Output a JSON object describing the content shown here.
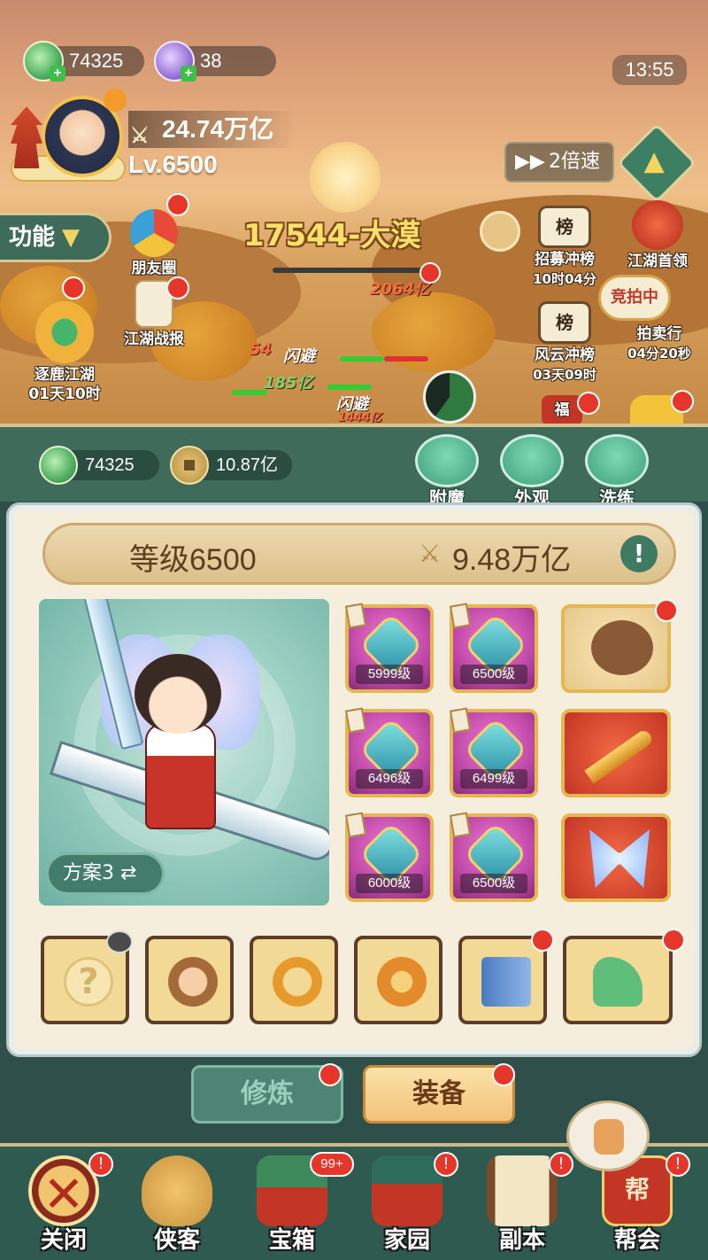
{
  "top_resources": {
    "jade": "74325",
    "purple": "38",
    "plus": "+"
  },
  "clock": "13:55",
  "player": {
    "power": "24.74万亿",
    "level": "Lv.6500"
  },
  "controls": {
    "speed": "2倍速",
    "func": "功能",
    "func_chevron": "▼",
    "collapse_chevron": "▲",
    "ff_glyph": "▶▶",
    "swords_glyph": "⚔"
  },
  "stage": {
    "title": "17544-大漠",
    "damage": [
      "2064亿",
      "54",
      "185亿",
      "1444亿"
    ],
    "dodge": [
      "闪避",
      "闪避"
    ]
  },
  "scene_icons": {
    "friends": "朋友圈",
    "battle_report": "江湖战报",
    "zhulu": "逐鹿江湖",
    "zhulu_time": "01天10时",
    "recruit": "招募冲榜",
    "recruit_time": "10时04分",
    "leader": "江湖首领",
    "auction_badge": "竞拍中",
    "fengyun": "风云冲榜",
    "fengyun_time": "03天09时",
    "auction": "拍卖行",
    "auction_time": "04分20秒",
    "bang": "榜",
    "fu": "福"
  },
  "panel_bar": {
    "jade": "74325",
    "coins": "10.87亿",
    "btn_enchant": "附魔",
    "btn_look": "外观",
    "btn_refine": "洗练"
  },
  "equip": {
    "level_label": "等级6500",
    "power": "9.48万亿",
    "info": "!",
    "plan": "方案3 ⇄",
    "slots": [
      "5999级",
      "6500级",
      "6496级",
      "6499级",
      "6000级",
      "6500级"
    ],
    "mystery": "?"
  },
  "subtabs": {
    "cultivate": "修炼",
    "equipment": "装备"
  },
  "nav": {
    "close": "关闭",
    "close_glyph": "✕",
    "heroes": "侠客",
    "chest": "宝箱",
    "chest_badge": "99+",
    "home": "家园",
    "dungeon": "副本",
    "guild": "帮会",
    "guild_emblem": "帮",
    "notice": "!"
  }
}
